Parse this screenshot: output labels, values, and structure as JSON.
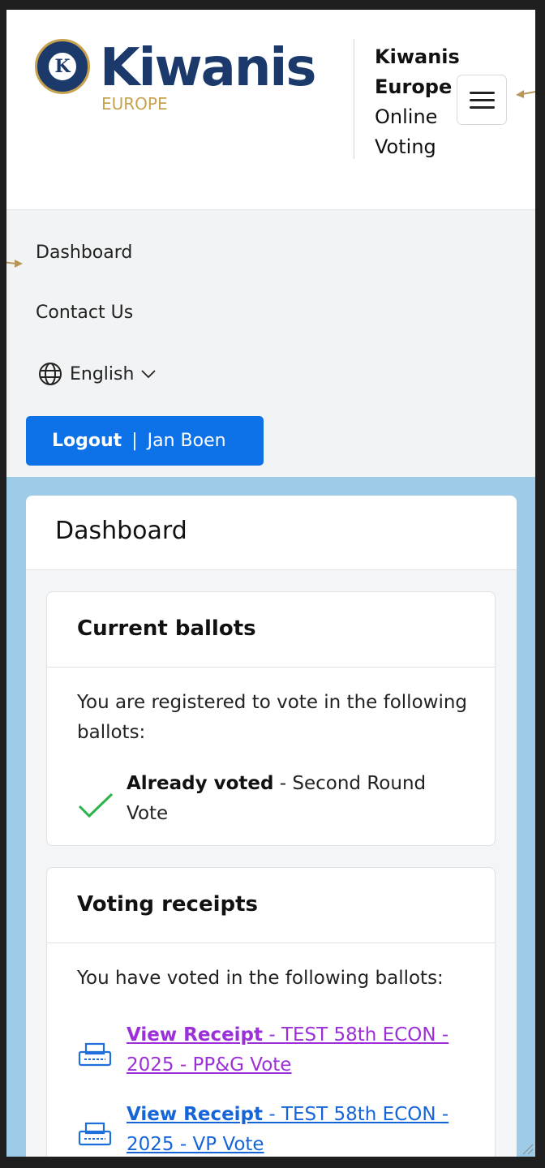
{
  "header": {
    "logo_wordmark": "Kiwanis",
    "logo_sub": "EUROPE",
    "logo_seal": "K",
    "site_title_line1": "Kiwanis",
    "site_title_line2": "Europe",
    "site_title_line3": "Online",
    "site_title_line4": "Voting",
    "menu_icon": "hamburger-menu-icon"
  },
  "nav": {
    "dashboard": "Dashboard",
    "contact": "Contact Us",
    "language": "English",
    "logout_label": "Logout",
    "separator": "|",
    "user_name": "Jan Boen"
  },
  "main": {
    "title": "Dashboard",
    "current_ballots": {
      "title": "Current ballots",
      "intro": "You are registered to vote in the following ballots:",
      "status_label": "Already voted",
      "status_detail": " - Second Round Vote"
    },
    "voting_receipts": {
      "title": "Voting receipts",
      "intro": "You have voted in the following ballots:",
      "items": [
        {
          "link_label": "View Receipt",
          "ballot": " - TEST 58th ECON - 2025 - PP&G Vote"
        },
        {
          "link_label": "View Receipt",
          "ballot": " - TEST 58th ECON - 2025 - VP Vote"
        }
      ]
    }
  },
  "colors": {
    "brand_navy": "#1b3a6b",
    "brand_gold": "#c7a24e",
    "primary_button": "#0d72e8",
    "visited_link": "#9b30d9",
    "link": "#1565d8",
    "check_green": "#2bb34a",
    "page_background": "#9dcbe8"
  }
}
